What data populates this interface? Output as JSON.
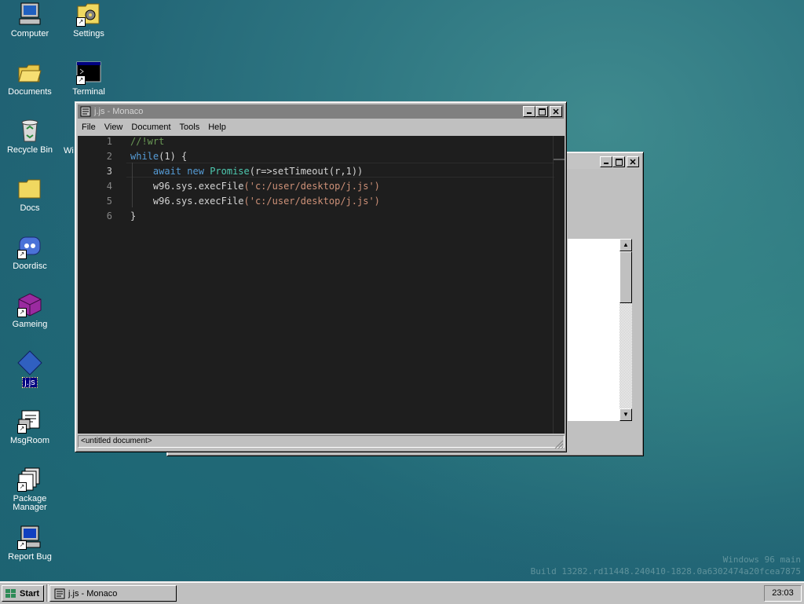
{
  "desktop": {
    "icons": [
      {
        "label": "Computer"
      },
      {
        "label": "Settings"
      },
      {
        "label": "Documents"
      },
      {
        "label": "Terminal"
      },
      {
        "label": "Recycle Bin"
      },
      {
        "label": "Docs"
      },
      {
        "label": "Doordisc"
      },
      {
        "label": "Gameing"
      },
      {
        "label": "j.js"
      },
      {
        "label": "MsgRoom"
      },
      {
        "label": "Package Manager"
      },
      {
        "label": "Report Bug"
      }
    ],
    "partial_label": "Wi"
  },
  "editor_window": {
    "title": "j.js - Monaco",
    "menu": [
      "File",
      "View",
      "Document",
      "Tools",
      "Help"
    ],
    "line_numbers": [
      "1",
      "2",
      "3",
      "4",
      "5",
      "6"
    ],
    "status": "<untitled document>",
    "current_line": 3
  },
  "code": {
    "l1": "//!wrt",
    "l2_kw": "while",
    "l2_rest": "(1) {",
    "l3_await": "await",
    "l3_new": "new",
    "l3_promise": "Promise",
    "l3_arrow": "(r=>setTimeout",
    "l3_args": "(r,1))",
    "l4_call": "w96.sys.execFile",
    "l4_str": "('c:/user/desktop/j.js')",
    "l5_call": "w96.sys.execFile",
    "l5_str": "('c:/user/desktop/j.js')",
    "l6": "}"
  },
  "watermark": {
    "line1": "Windows 96 main",
    "line2": "Build 13282.rd11448.240410-1828.0a6302474a20fcea7875"
  },
  "taskbar": {
    "start_label": "Start",
    "task_label": "j.js - Monaco",
    "clock": "23:03"
  }
}
